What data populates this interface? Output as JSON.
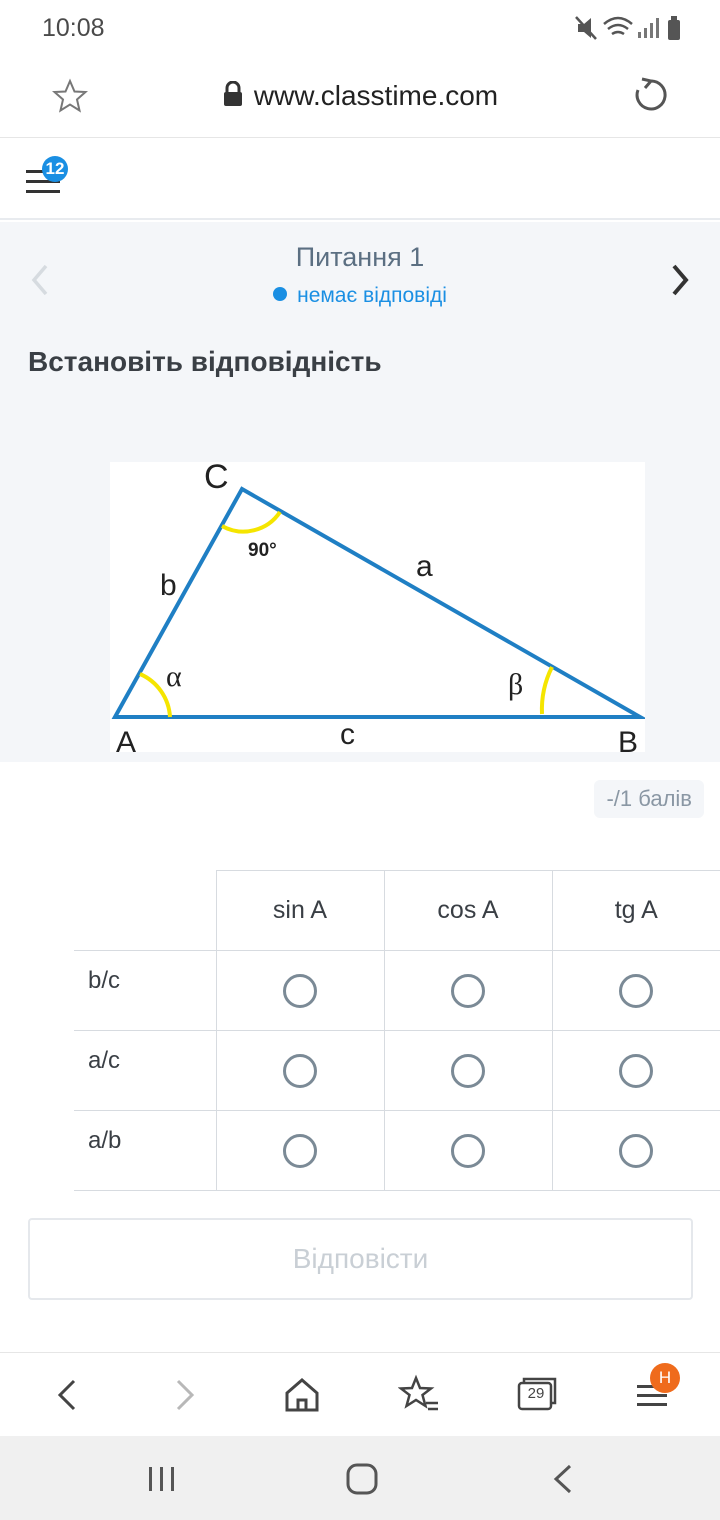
{
  "status_bar": {
    "time": "10:08"
  },
  "browser": {
    "url": "www.classtime.com"
  },
  "app_header": {
    "notification_count": "12"
  },
  "question": {
    "title": "Питання 1",
    "status": "немає відповіді",
    "prompt": "Встановіть відповідність",
    "points": "-/1 балів"
  },
  "figure": {
    "vertex_labels": {
      "A": "A",
      "B": "B",
      "C": "C"
    },
    "side_labels": {
      "a": "a",
      "b": "b",
      "c": "c"
    },
    "angle_labels": {
      "alpha": "α",
      "beta": "β",
      "right": "90°"
    },
    "colors": {
      "triangle": "#1f7fc4",
      "angle_arc": "#f5e500"
    }
  },
  "matrix": {
    "columns": [
      "sin A",
      "cos A",
      "tg A"
    ],
    "rows": [
      "b/c",
      "a/c",
      "a/b"
    ]
  },
  "submit": {
    "label": "Відповісти"
  },
  "browser_toolbar": {
    "tabs_count": "29",
    "menu_badge": "Н"
  }
}
